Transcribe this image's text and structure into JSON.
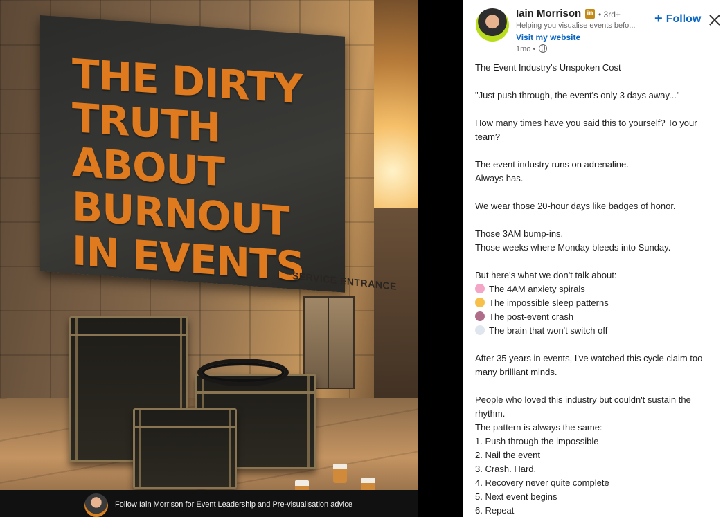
{
  "image": {
    "headline_lines": [
      "THE DIRTY",
      "TRUTH ABOUT",
      "BURNOUT",
      "IN EVENTS"
    ],
    "service_sign": "SERVICE ENTRANCE",
    "caption": "Follow Iain Morrison for Event Leadership and Pre-visualisation advice"
  },
  "author": {
    "name": "Iain Morrison",
    "badge": "in",
    "degree": "• 3rd+",
    "headline": "Helping you visualise events befo...",
    "website_label": "Visit my website",
    "time": "1mo •"
  },
  "actions": {
    "follow_label": "Follow"
  },
  "post": {
    "lines": [
      {
        "text": "The Event Industry's Unspoken Cost"
      },
      {
        "text": ""
      },
      {
        "text": "\"Just push through, the event's only 3 days away...\""
      },
      {
        "text": ""
      },
      {
        "text": "How many times have you said this to yourself? To your team?"
      },
      {
        "text": ""
      },
      {
        "text": "The event industry runs on adrenaline."
      },
      {
        "text": "Always has."
      },
      {
        "text": ""
      },
      {
        "text": "We wear those 20-hour days like badges of honor."
      },
      {
        "text": ""
      },
      {
        "text": "Those 3AM bump-ins."
      },
      {
        "text": "Those weeks where Monday bleeds into Sunday."
      },
      {
        "text": ""
      },
      {
        "text": "But here's what we don't talk about:"
      },
      {
        "text": "The 4AM anxiety spirals",
        "icon": "brain-icon",
        "color": "#f4a6c6"
      },
      {
        "text": "The impossible sleep patterns",
        "icon": "sleepy-face-icon",
        "color": "#f6c04a"
      },
      {
        "text": "The post-event crash",
        "icon": "person-meditating-icon",
        "color": "#b06d8a"
      },
      {
        "text": "The brain that won't switch off",
        "icon": "thought-bubble-icon",
        "color": "#dfe6ee"
      },
      {
        "text": ""
      },
      {
        "text": "After 35 years in events, I've watched this cycle claim too many brilliant minds."
      },
      {
        "text": ""
      },
      {
        "text": "People who loved this industry but couldn't sustain the rhythm."
      },
      {
        "text": "The pattern is always the same:"
      },
      {
        "text": "1. Push through the impossible"
      },
      {
        "text": "2. Nail the event"
      },
      {
        "text": "3. Crash. Hard."
      },
      {
        "text": "4. Recovery never quite complete"
      },
      {
        "text": "5. Next event begins"
      },
      {
        "text": "6. Repeat"
      }
    ]
  },
  "colors": {
    "link": "#0a66c2",
    "headline_orange": "#e07a1f",
    "premium_badge": "#c38a16"
  }
}
